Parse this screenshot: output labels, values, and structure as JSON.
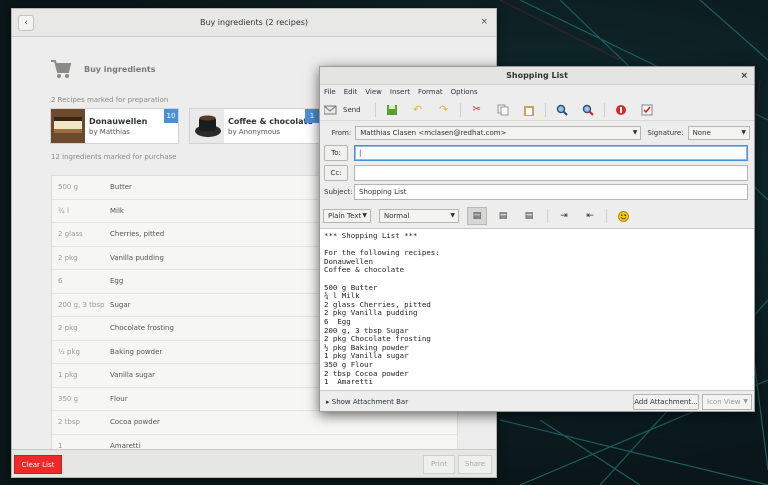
{
  "recipes_window": {
    "title": "Buy ingredients (2 recipes)",
    "heading": "Buy ingredients",
    "recipes_marked": "2 Recipes marked for preparation",
    "recipes": [
      {
        "name": "Donauwellen",
        "author": "by Matthias",
        "count": "10"
      },
      {
        "name": "Coffee & chocolate",
        "author": "by Anonymous",
        "count": "1"
      }
    ],
    "ingredients_marked": "12 ingredients marked for purchase",
    "ingredients": [
      {
        "qty": "500 g",
        "name": "Butter"
      },
      {
        "qty": "¾ l",
        "name": "Milk"
      },
      {
        "qty": "2 glass",
        "name": "Cherries, pitted"
      },
      {
        "qty": "2 pkg",
        "name": "Vanilla pudding"
      },
      {
        "qty": "6",
        "name": "Egg"
      },
      {
        "qty": "200 g, 3 tbsp",
        "name": "Sugar"
      },
      {
        "qty": "2 pkg",
        "name": "Chocolate frosting"
      },
      {
        "qty": "½ pkg",
        "name": "Baking powder"
      },
      {
        "qty": "1 pkg",
        "name": "Vanilla sugar"
      },
      {
        "qty": "350 g",
        "name": "Flour"
      },
      {
        "qty": "2 tbsp",
        "name": "Cocoa powder"
      },
      {
        "qty": "1",
        "name": "Amaretti"
      }
    ],
    "clear_label": "Clear List",
    "print_label": "Print",
    "share_label": "Share"
  },
  "compose_window": {
    "title": "Shopping List",
    "menu": [
      "File",
      "Edit",
      "View",
      "Insert",
      "Format",
      "Options"
    ],
    "send_label": "Send",
    "from_label": "From:",
    "from_value": "Matthias Clasen <mclasen@redhat.com>",
    "signature_label": "Signature:",
    "signature_value": "None",
    "to_label": "To:",
    "cc_label": "Cc:",
    "subject_label": "Subject:",
    "subject_value": "Shopping List",
    "format_value": "Plain Text",
    "style_value": "Normal",
    "body": "*** Shopping List ***\n\nFor the following recipes:\nDonauwellen\nCoffee & chocolate\n\n500 g Butter\n¾ l Milk\n2 glass Cherries, pitted\n2 pkg Vanilla pudding\n6  Egg\n200 g, 3 tbsp Sugar\n2 pkg Chocolate frosting\n½ pkg Baking powder\n1 pkg Vanilla sugar\n350 g Flour\n2 tbsp Cocoa powder\n1  Amaretti",
    "show_attachment_bar": "Show Attachment Bar",
    "add_attachment": "Add Attachment...",
    "icon_view": "Icon View"
  }
}
